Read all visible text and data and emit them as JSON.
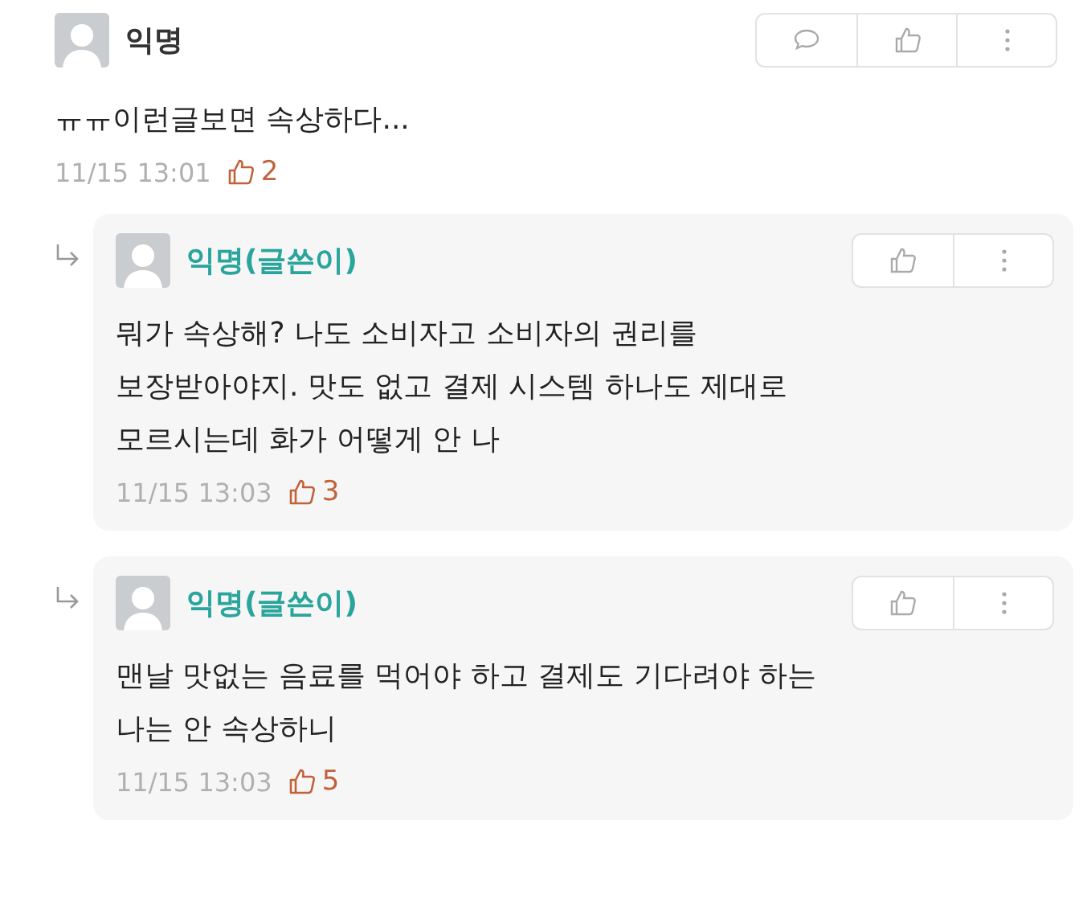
{
  "comments": [
    {
      "kind": "comment",
      "author": "익명",
      "is_writer": false,
      "body": [
        "ㅠㅠ이런글보면 속상하다..."
      ],
      "time": "11/15 13:01",
      "likes": "2"
    },
    {
      "kind": "reply",
      "author": "익명(글쓴이)",
      "is_writer": true,
      "body": [
        "뭐가 속상해? 나도 소비자고 소비자의 권리를",
        "보장받아야지. 맛도 없고 결제 시스템 하나도 제대로",
        "모르시는데 화가 어떻게 안 나"
      ],
      "time": "11/15 13:03",
      "likes": "3"
    },
    {
      "kind": "reply",
      "author": "익명(글쓴이)",
      "is_writer": true,
      "body": [
        "맨날 맛없는 음료를 먹어야 하고 결제도 기다려야 하는",
        "나는 안 속상하니"
      ],
      "time": "11/15 13:03",
      "likes": "5"
    }
  ]
}
